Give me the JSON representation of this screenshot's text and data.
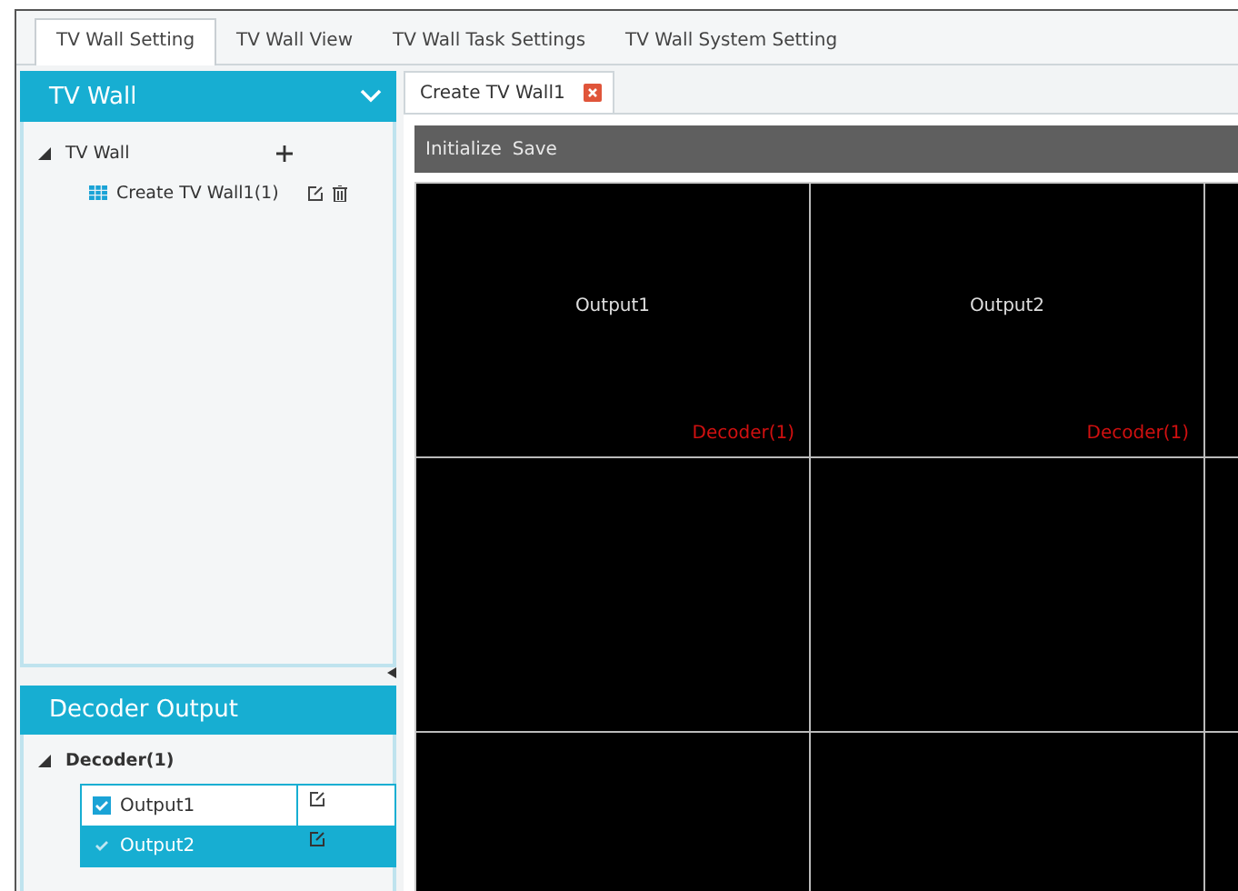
{
  "tabs": [
    {
      "label": "TV Wall Setting",
      "selected": true
    },
    {
      "label": "TV Wall View",
      "selected": false
    },
    {
      "label": "TV Wall Task Settings",
      "selected": false
    },
    {
      "label": "TV Wall System Setting",
      "selected": false
    }
  ],
  "tv_wall_panel": {
    "title": "TV Wall",
    "tree": [
      {
        "label": "TV Wall",
        "expanded": true,
        "children": [
          {
            "label": "Create TV Wall1(1)"
          }
        ]
      }
    ]
  },
  "decoder_panel": {
    "title": "Decoder Output",
    "decoder": {
      "label": "Decoder(1)",
      "expanded": true
    },
    "outputs": [
      {
        "label": "Output1",
        "checked": true,
        "selected": false
      },
      {
        "label": "Output2",
        "checked": true,
        "selected": true
      }
    ]
  },
  "doc_tab": {
    "label": "Create TV Wall1"
  },
  "toolbar": [
    "Initialize",
    "Save"
  ],
  "screens": [
    {
      "output": "Output1",
      "decoder": "Decoder(1)"
    },
    {
      "output": "Output2",
      "decoder": "Decoder(1)"
    }
  ]
}
